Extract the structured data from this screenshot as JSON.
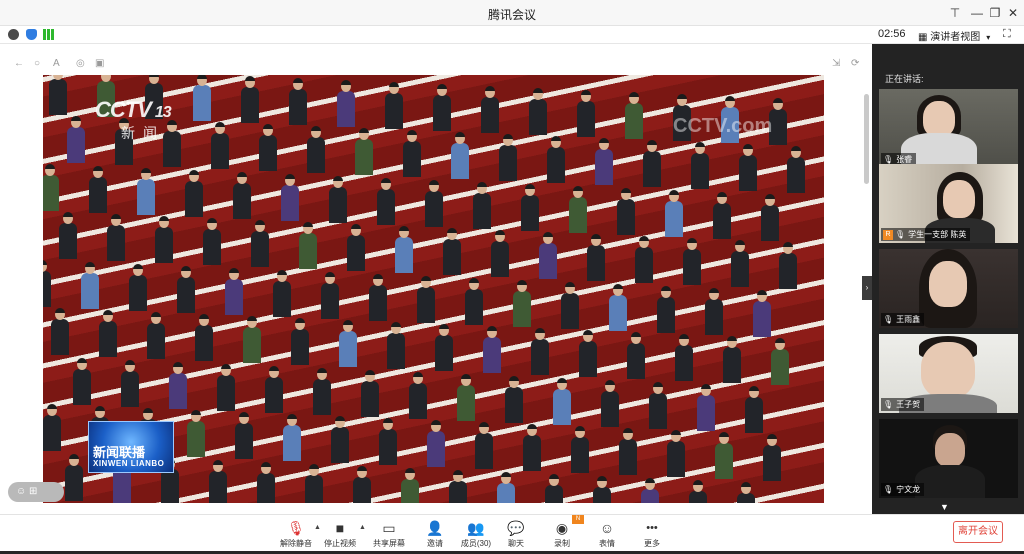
{
  "window": {
    "title": "腾讯会议",
    "controls": {
      "pin": "⊤",
      "minimize": "—",
      "restore": "❐",
      "close": "✕"
    }
  },
  "status": {
    "timer": "02:56",
    "view_mode": "演讲者视图",
    "caret": "▾",
    "fullscreen": "⛶",
    "icons": [
      "info-icon",
      "shield-icon",
      "signal-icon"
    ],
    "colors": {
      "info": "#4a4a4a",
      "shield": "#2f7de1",
      "signal": "#2eb82e"
    }
  },
  "share": {
    "toolbar_icons": [
      "←",
      "○",
      "A",
      "◎",
      "▣"
    ],
    "toolbar_right": [
      "⇲",
      "⟳"
    ],
    "collapse_arrow": "›",
    "float_label": "☺ ⊞",
    "video": {
      "channel_logo": "CCTV",
      "channel_number": "13",
      "channel_sub": "新闻",
      "watermark": "CCTV.com",
      "program_name_cn": "新闻联播",
      "program_name_en": "XINWEN LIANBO"
    }
  },
  "panel": {
    "speaking_label": "正在讲话:",
    "participants": [
      {
        "name": "张睿",
        "org": ""
      },
      {
        "name": "学生一支部 陈英",
        "org": "R"
      },
      {
        "name": "王雨鑫",
        "org": ""
      },
      {
        "name": "王子贺",
        "org": ""
      },
      {
        "name": "宁文龙",
        "org": ""
      }
    ],
    "mic_icon": "🎙",
    "more_arrow": "▼"
  },
  "toolbar": {
    "buttons": [
      {
        "id": "unmute",
        "label": "解除静音",
        "icon": "🎙"
      },
      {
        "id": "stop-video",
        "label": "停止视频",
        "icon": "■"
      },
      {
        "id": "share-screen",
        "label": "共享屏幕",
        "icon": "▭"
      },
      {
        "id": "invite",
        "label": "邀请",
        "icon": "👤"
      },
      {
        "id": "members",
        "label": "成员(30)",
        "icon": "👥"
      },
      {
        "id": "chat",
        "label": "聊天",
        "icon": "💬"
      },
      {
        "id": "record",
        "label": "录制",
        "icon": "◉"
      },
      {
        "id": "reaction",
        "label": "表情",
        "icon": "☺"
      },
      {
        "id": "more",
        "label": "更多",
        "icon": "•••"
      }
    ],
    "caret": "▲",
    "new_badge": "N",
    "leave_label": "离开会议"
  }
}
